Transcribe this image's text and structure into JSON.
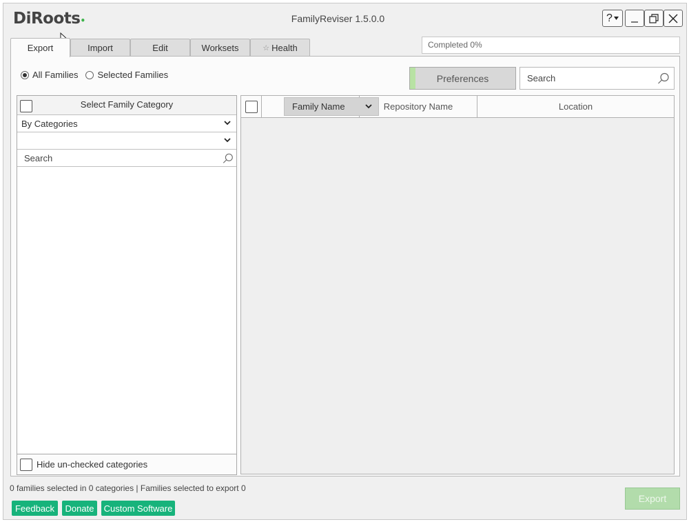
{
  "app": {
    "logo": "DiRoots",
    "title": "FamilyReviser 1.5.0.0"
  },
  "window_controls": {
    "help_label": "?",
    "help_icon": "help-dropdown-icon",
    "minimize_icon": "minimize-icon",
    "restore_icon": "restore-icon",
    "close_icon": "close-icon"
  },
  "progress": {
    "text": "Completed 0%",
    "value": 0
  },
  "tabs": [
    {
      "label": "Export",
      "active": true
    },
    {
      "label": "Import",
      "active": false
    },
    {
      "label": "Edit",
      "active": false
    },
    {
      "label": "Worksets",
      "active": false
    },
    {
      "label": "Health",
      "active": false,
      "icon": "star-icon"
    }
  ],
  "filter": {
    "options": [
      "All Families",
      "Selected Families"
    ],
    "selected": "All Families"
  },
  "preferences": {
    "label": "Preferences"
  },
  "search": {
    "placeholder": "Search"
  },
  "category_panel": {
    "header": "Select Family Category",
    "dropdown1_value": "By Categories",
    "dropdown2_value": "",
    "search_placeholder": "Search",
    "hide_label": "Hide un-checked categories"
  },
  "grid": {
    "columns": [
      "Family Name",
      "Repository Name",
      "Location"
    ],
    "rows": []
  },
  "status": {
    "text": "0 families selected in 0 categories | Families selected to export 0"
  },
  "actions": {
    "export_label": "Export",
    "feedback_label": "Feedback",
    "donate_label": "Donate",
    "custom_software_label": "Custom Software"
  },
  "colors": {
    "accent_green": "#17b37b",
    "export_disabled": "#b2dcab",
    "preferences_indicator": "#b8e2a4"
  }
}
